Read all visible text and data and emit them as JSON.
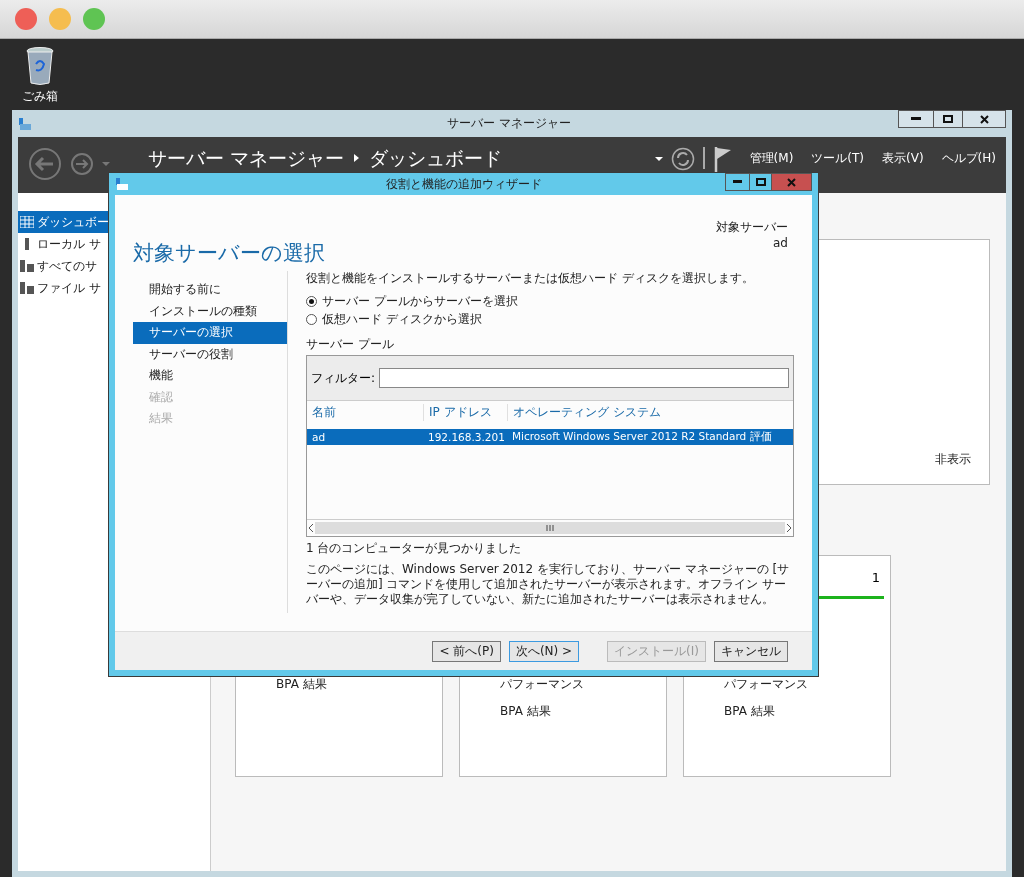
{
  "desktop": {
    "trash_label": "ごみ箱"
  },
  "server_manager": {
    "title": "サーバー マネージャー",
    "breadcrumb": [
      "サーバー マネージャー",
      "ダッシュボード"
    ],
    "menu": [
      "管理(M)",
      "ツール(T)",
      "表示(V)",
      "ヘルプ(H)"
    ],
    "sidebar": [
      {
        "label": "ダッシュボー",
        "selected": true
      },
      {
        "label": "ローカル サ",
        "selected": false
      },
      {
        "label": "すべてのサ",
        "selected": false
      },
      {
        "label": "ファイル サ",
        "selected": false
      }
    ],
    "panel_link": "非表示",
    "tile_count": "1",
    "cards": [
      {
        "items": [
          "BPA 結果"
        ]
      },
      {
        "items": [
          "パフォーマンス",
          "BPA 結果"
        ]
      },
      {
        "items": [
          "パフォーマンス",
          "BPA 結果"
        ]
      }
    ]
  },
  "wizard": {
    "title": "役割と機能の追加ウィザード",
    "heading": "対象サーバーの選択",
    "target_label": "対象サーバー",
    "target_value": "ad",
    "steps": [
      {
        "label": "開始する前に",
        "selected": false,
        "disabled": false
      },
      {
        "label": "インストールの種類",
        "selected": false,
        "disabled": false
      },
      {
        "label": "サーバーの選択",
        "selected": true,
        "disabled": false
      },
      {
        "label": "サーバーの役割",
        "selected": false,
        "disabled": false
      },
      {
        "label": "機能",
        "selected": false,
        "disabled": false
      },
      {
        "label": "確認",
        "selected": false,
        "disabled": true
      },
      {
        "label": "結果",
        "selected": false,
        "disabled": true
      }
    ],
    "instruction": "役割と機能をインストールするサーバーまたは仮想ハード ディスクを選択します。",
    "options": [
      {
        "label": "サーバー プールからサーバーを選択",
        "selected": true
      },
      {
        "label": "仮想ハード ディスクから選択",
        "selected": false
      }
    ],
    "pool_title": "サーバー プール",
    "filter_label": "フィルター:",
    "columns": [
      "名前",
      "IP アドレス",
      "オペレーティング システム"
    ],
    "rows": [
      {
        "cells": [
          "ad",
          "192.168.3.201",
          "Microsoft Windows Server 2012 R2 Standard 評価"
        ],
        "selected": true
      }
    ],
    "found": "1 台のコンピューターが見つかりました",
    "note": "このページには、Windows Server 2012 を実行しており、サーバー マネージャーの [サーバーの追加] コマンドを使用して追加されたサーバーが表示されます。オフライン サーバーや、データ収集が完了していない、新たに追加されたサーバーは表示されません。",
    "buttons": [
      {
        "label": "< 前へ(P)",
        "disabled": false,
        "default": false
      },
      {
        "label": "次へ(N) >",
        "disabled": false,
        "default": true
      },
      {
        "label": "インストール(I)",
        "disabled": true,
        "default": false
      },
      {
        "label": "キャンセル",
        "disabled": false,
        "default": false
      }
    ]
  }
}
